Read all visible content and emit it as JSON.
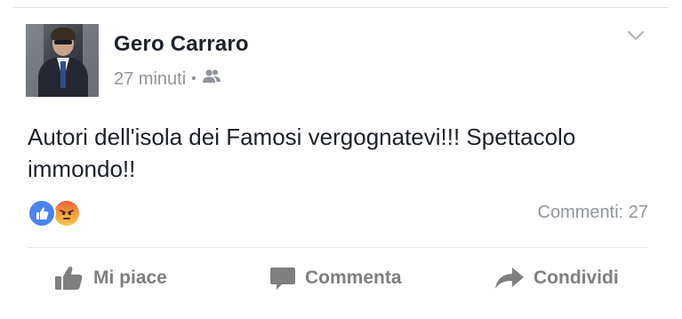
{
  "post": {
    "author": "Gero Carraro",
    "time": "27 minuti",
    "separator": "•",
    "audience_icon": "friends-icon",
    "message_line1": "Autori dell'isola dei Famosi vergognatevi!!! Spettacolo",
    "message_line2": "immondo!!",
    "reactions": [
      "like-reaction",
      "angry-reaction"
    ],
    "comments_label": "Commenti: 27",
    "actions": {
      "like": "Mi piace",
      "comment": "Commenta",
      "share": "Condividi"
    }
  },
  "colors": {
    "name": "#1d2129",
    "meta": "#90949c",
    "like_blue": "#4a84f0",
    "action_gray": "#7f7f7f"
  }
}
